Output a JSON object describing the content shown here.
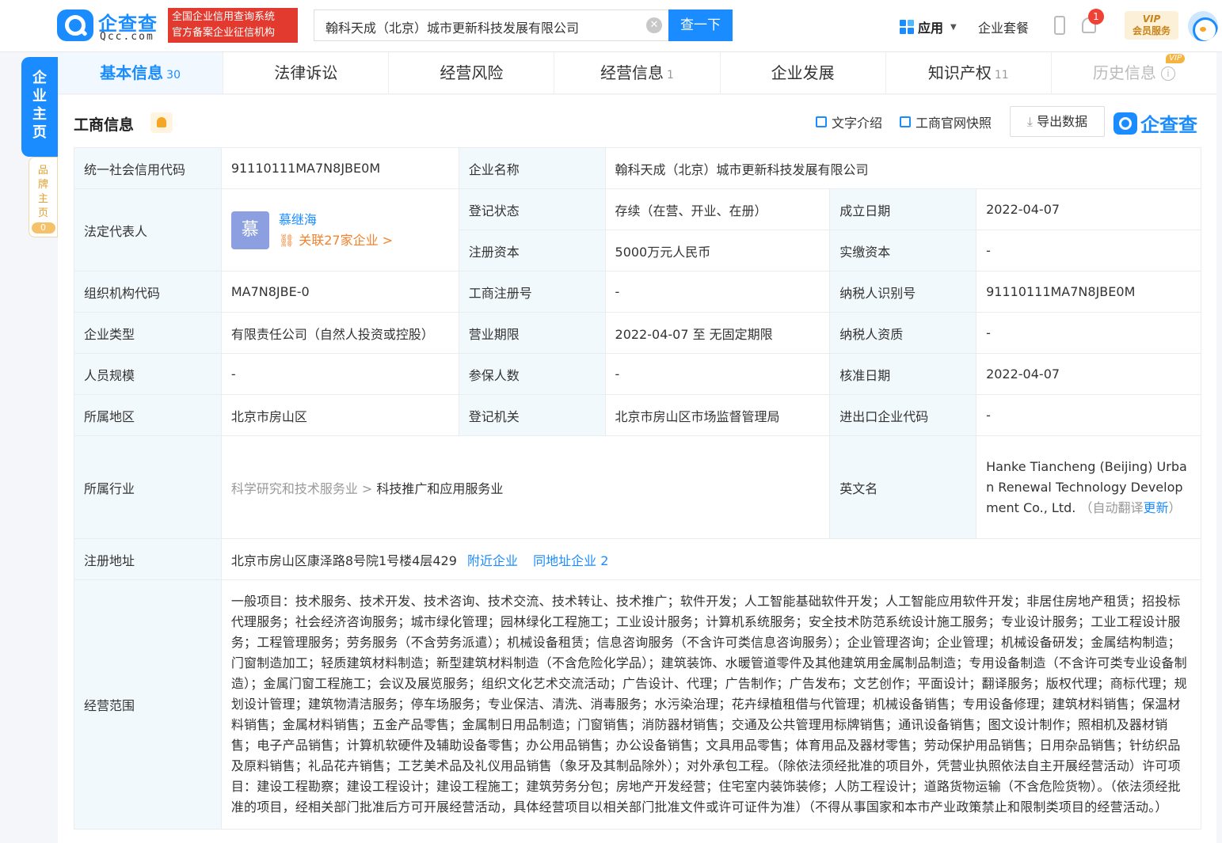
{
  "header": {
    "logo_cn": "企查查",
    "logo_en": "Qcc.com",
    "gov_badge_line1": "全国企业信用查询系统",
    "gov_badge_line2": "官方备案企业征信机构",
    "search_value": "翰科天成（北京）城市更新科技发展有限公司",
    "search_button": "查一下",
    "apps_label": "应用",
    "package_label": "企业套餐",
    "notification_count": "1",
    "vip_line1": "VIP",
    "vip_line2": "会员服务"
  },
  "side": {
    "main_label": "企业主页",
    "brand_label": "品牌主页",
    "brand_count": "0"
  },
  "tabs": [
    {
      "label": "基本信息",
      "count": "30"
    },
    {
      "label": "法律诉讼",
      "count": ""
    },
    {
      "label": "经营风险",
      "count": ""
    },
    {
      "label": "经营信息",
      "count": "1"
    },
    {
      "label": "企业发展",
      "count": ""
    },
    {
      "label": "知识产权",
      "count": "11"
    },
    {
      "label": "历史信息",
      "count": "",
      "vip": "VIP"
    }
  ],
  "section": {
    "title": "工商信息",
    "text_intro": "文字介绍",
    "snapshot": "工商官网快照",
    "export": "导出数据",
    "brand": "企查查"
  },
  "info": {
    "credit_code_k": "统一社会信用代码",
    "credit_code_v": "91110111MA7N8JBE0M",
    "company_name_k": "企业名称",
    "company_name_v": "翰科天成（北京）城市更新科技发展有限公司",
    "legal_rep_k": "法定代表人",
    "legal_rep_avatar": "慕",
    "legal_rep_name": "慕继海",
    "legal_rep_related": "关联27家企业 >",
    "status_k": "登记状态",
    "status_v": "存续（在营、开业、在册）",
    "est_date_k": "成立日期",
    "est_date_v": "2022-04-07",
    "reg_capital_k": "注册资本",
    "reg_capital_v": "5000万元人民币",
    "paid_capital_k": "实缴资本",
    "paid_capital_v": "-",
    "org_code_k": "组织机构代码",
    "org_code_v": "MA7N8JBE-0",
    "reg_no_k": "工商注册号",
    "reg_no_v": "-",
    "taxpayer_id_k": "纳税人识别号",
    "taxpayer_id_v": "91110111MA7N8JBE0M",
    "type_k": "企业类型",
    "type_v": "有限责任公司（自然人投资或控股）",
    "term_k": "营业期限",
    "term_v": "2022-04-07 至 无固定期限",
    "taxpayer_qual_k": "纳税人资质",
    "taxpayer_qual_v": "-",
    "staff_k": "人员规模",
    "staff_v": "-",
    "insured_k": "参保人数",
    "insured_v": "-",
    "approve_k": "核准日期",
    "approve_v": "2022-04-07",
    "region_k": "所属地区",
    "region_v": "北京市房山区",
    "authority_k": "登记机关",
    "authority_v": "北京市房山区市场监督管理局",
    "import_export_k": "进出口企业代码",
    "import_export_v": "-",
    "industry_k": "所属行业",
    "industry_parent": "科学研究和技术服务业",
    "industry_sep": " > ",
    "industry_child": "科技推广和应用服务业",
    "english_k": "英文名",
    "english_v": "Hanke Tiancheng (Beijing) Urban Renewal Technology Development Co., Ltd.",
    "english_note_pre": "（自动翻译",
    "english_note_link": "更新",
    "english_note_post": "）",
    "address_k": "注册地址",
    "address_v": "北京市房山区康泽路8号院1号楼4层429",
    "nearby": "附近企业",
    "same_address": "同地址企业 2",
    "scope_k": "经营范围",
    "scope_v": "一般项目：技术服务、技术开发、技术咨询、技术交流、技术转让、技术推广；软件开发；人工智能基础软件开发；人工智能应用软件开发；非居住房地产租赁；招投标代理服务；社会经济咨询服务；城市绿化管理；园林绿化工程施工；工业设计服务；计算机系统服务；安全技术防范系统设计施工服务；专业设计服务；工业工程设计服务；工程管理服务；劳务服务（不含劳务派遣）；机械设备租赁；信息咨询服务（不含许可类信息咨询服务）；企业管理咨询；企业管理；机械设备研发；金属结构制造；门窗制造加工；轻质建筑材料制造；新型建筑材料制造（不含危险化学品）；建筑装饰、水暖管道零件及其他建筑用金属制品制造；专用设备制造（不含许可类专业设备制造）；金属门窗工程施工；会议及展览服务；组织文化艺术交流活动；广告设计、代理；广告制作；广告发布；文艺创作；平面设计；翻译服务；版权代理；商标代理；规划设计管理；建筑物清洁服务；停车场服务；专业保洁、清洗、消毒服务；水污染治理；花卉绿植租借与代管理；机械设备销售；专用设备修理；建筑材料销售；保温材料销售；金属材料销售；五金产品零售；金属制日用品制造；门窗销售；消防器材销售；交通及公共管理用标牌销售；通讯设备销售；图文设计制作；照相机及器材销售；电子产品销售；计算机软硬件及辅助设备零售；办公用品销售；办公设备销售；文具用品零售；体育用品及器材零售；劳动保护用品销售；日用杂品销售；针纺织品及原料销售；礼品花卉销售；工艺美术品及礼仪用品销售（象牙及其制品除外）；对外承包工程。（除依法须经批准的项目外，凭营业执照依法自主开展经营活动）许可项目：建设工程勘察；建设工程设计；建设工程施工；建筑劳务分包；房地产开发经营；住宅室内装饰装修；人防工程设计；道路货物运输（不含危险货物）。（依法须经批准的项目，经相关部门批准后方可开展经营活动，具体经营项目以相关部门批准文件或许可证件为准）（不得从事国家和本市产业政策禁止和限制类项目的经营活动。）"
  }
}
